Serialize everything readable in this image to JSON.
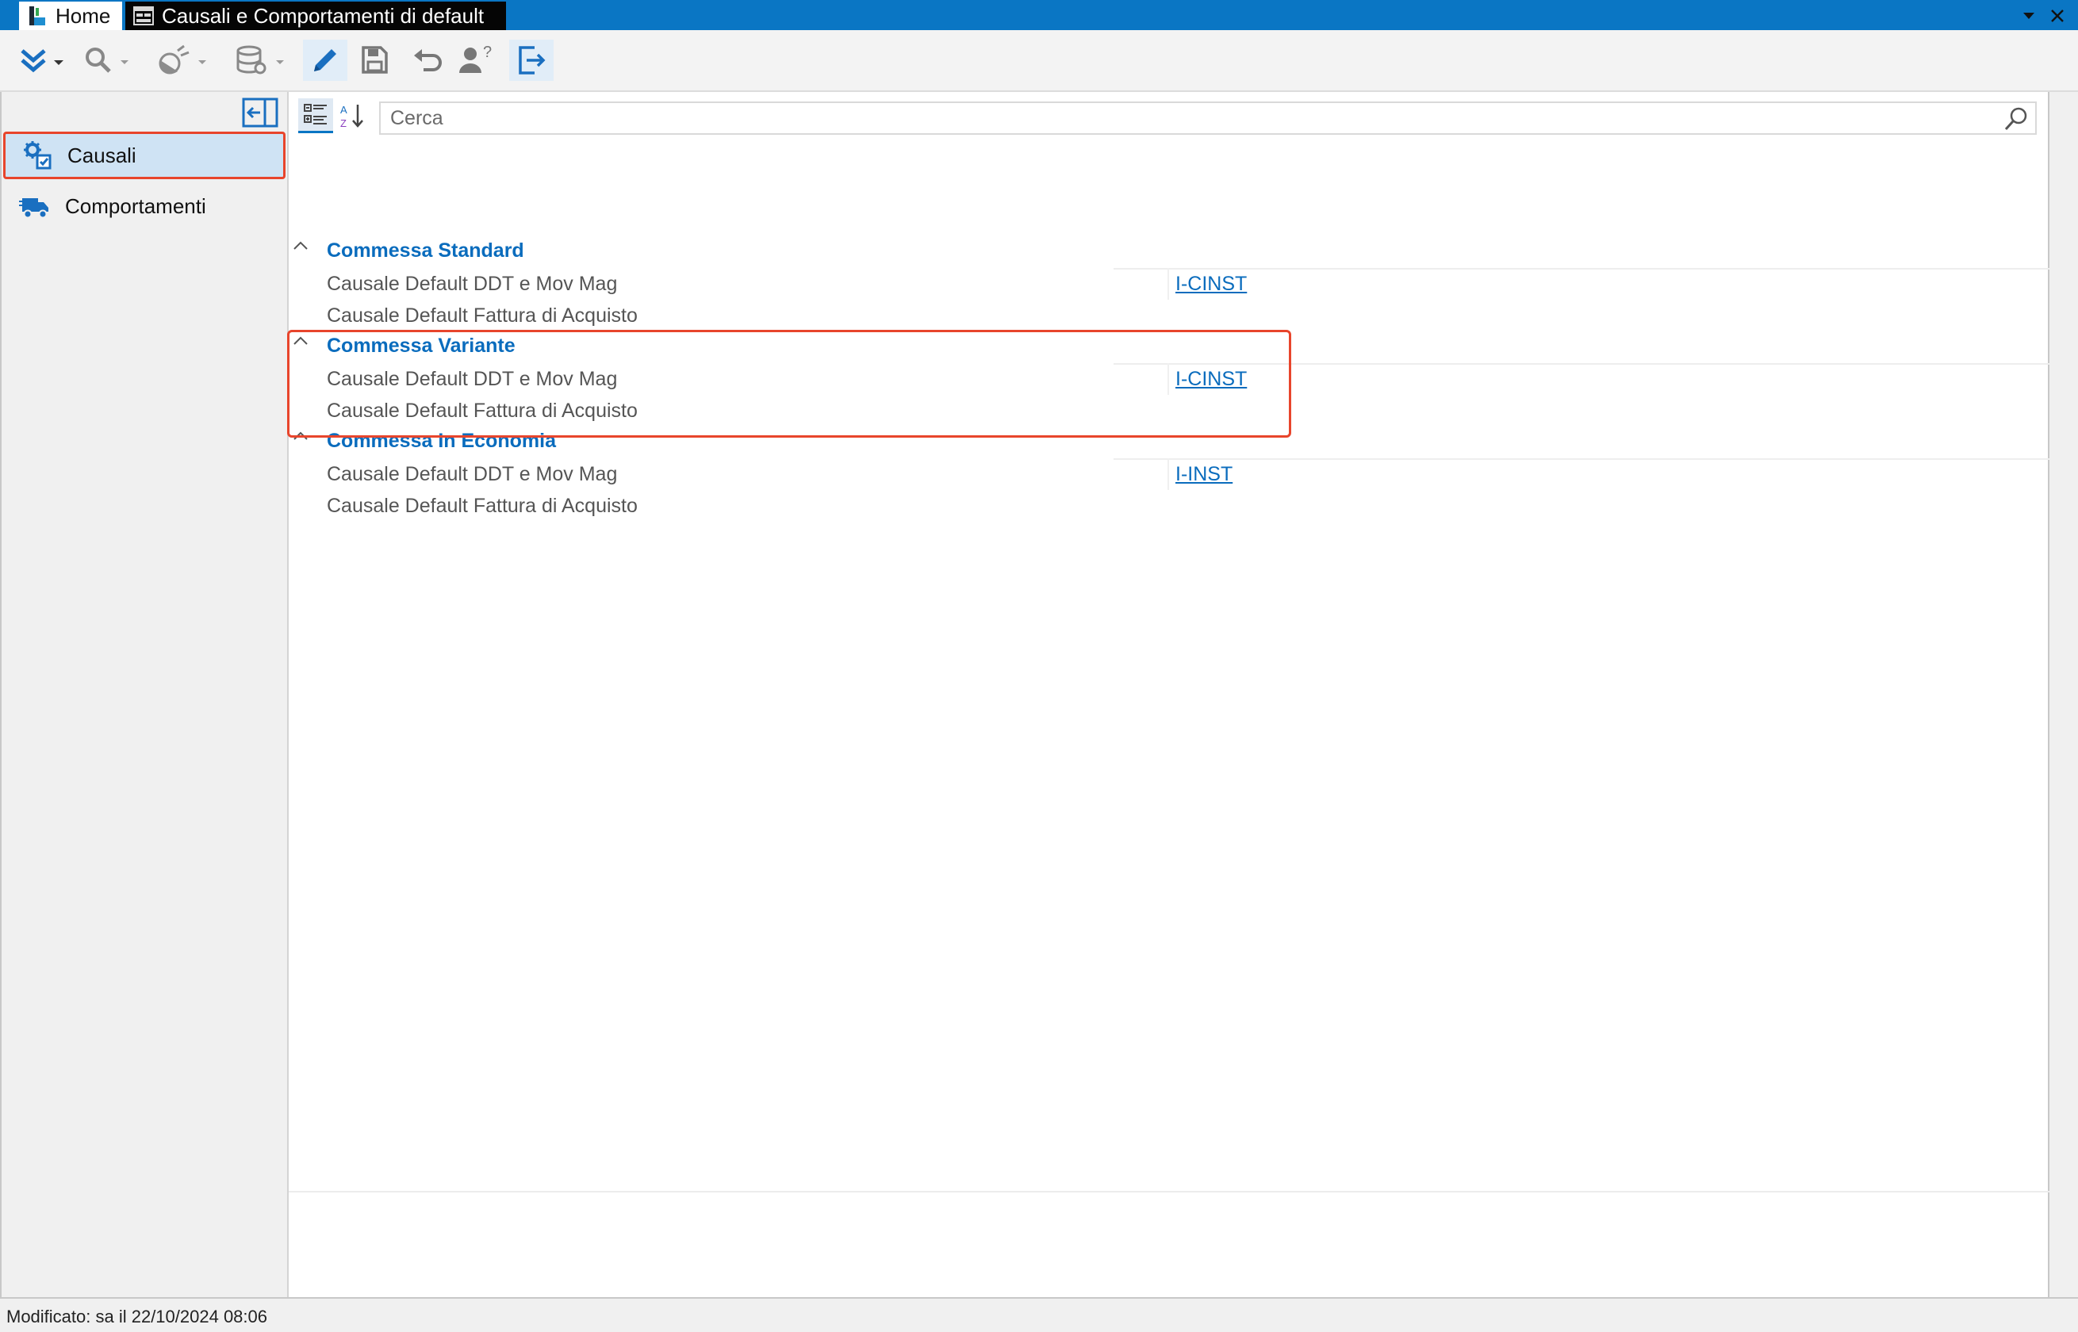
{
  "window": {
    "tabs": [
      {
        "label": "Home",
        "icon": "home-app-icon"
      },
      {
        "label": "Causali e Comportamenti di default",
        "icon": "form-icon"
      }
    ]
  },
  "toolbar": {
    "buttons": [
      {
        "name": "expand-menu",
        "icon": "double-chevron-down-icon"
      },
      {
        "name": "search",
        "icon": "search-icon"
      },
      {
        "name": "satellite",
        "icon": "satellite-icon"
      },
      {
        "name": "database",
        "icon": "database-icon"
      },
      {
        "name": "edit",
        "icon": "pencil-icon"
      },
      {
        "name": "save",
        "icon": "save-icon"
      },
      {
        "name": "undo",
        "icon": "undo-icon"
      },
      {
        "name": "help-user",
        "icon": "user-question-icon"
      },
      {
        "name": "exit",
        "icon": "exit-icon"
      }
    ]
  },
  "sidebar": {
    "items": [
      {
        "label": "Causali",
        "icon": "gear-doc-icon",
        "active": true
      },
      {
        "label": "Comportamenti",
        "icon": "truck-icon",
        "active": false
      }
    ]
  },
  "search": {
    "placeholder": "Cerca"
  },
  "groups": [
    {
      "title": "Commessa Standard",
      "rows": [
        {
          "name": "Causale Default DDT e Mov Mag",
          "value": "I-CINST"
        },
        {
          "name": "Causale Default Fattura di Acquisto",
          "value": ""
        }
      ]
    },
    {
      "title": "Commessa Variante",
      "rows": [
        {
          "name": "Causale Default DDT e Mov Mag",
          "value": "I-CINST"
        },
        {
          "name": "Causale Default Fattura di Acquisto",
          "value": ""
        }
      ]
    },
    {
      "title": "Commessa In Economia",
      "rows": [
        {
          "name": "Causale Default DDT e Mov Mag",
          "value": "I-INST"
        },
        {
          "name": "Causale Default Fattura di Acquisto",
          "value": ""
        }
      ]
    }
  ],
  "status": {
    "text": "Modificato: sa il 22/10/2024 08:06"
  },
  "colors": {
    "accent": "#0a76c4",
    "highlight": "#e8452c",
    "group_title": "#0a6cbd"
  }
}
